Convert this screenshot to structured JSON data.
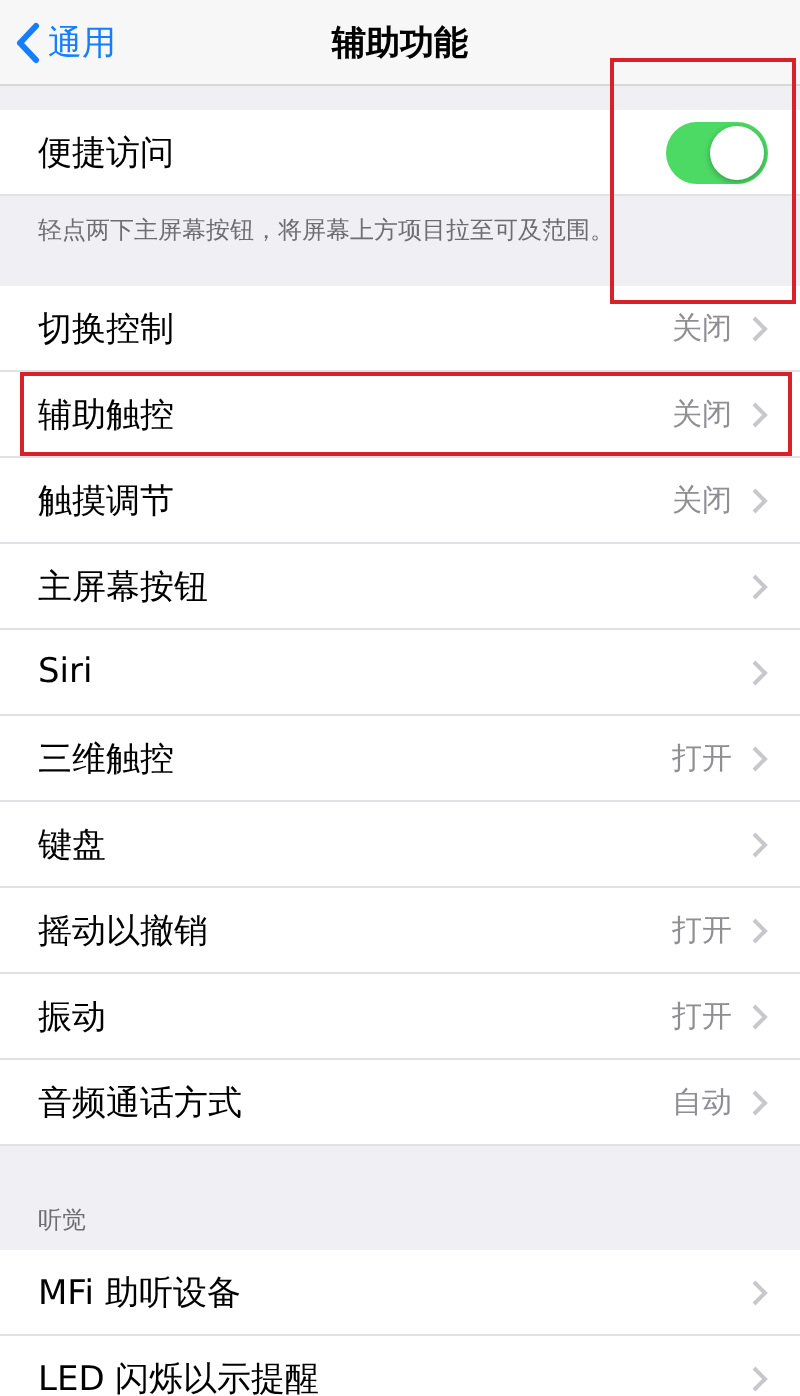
{
  "nav": {
    "back": "通用",
    "title": "辅助功能"
  },
  "reach": {
    "label": "便捷访问",
    "on": true,
    "highlighted": true,
    "footnote": "轻点两下主屏幕按钮，将屏幕上方项目拉至可及范围。"
  },
  "rows": [
    {
      "label": "切换控制",
      "value": "关闭",
      "highlighted": false
    },
    {
      "label": "辅助触控",
      "value": "关闭",
      "highlighted": true
    },
    {
      "label": "触摸调节",
      "value": "关闭",
      "highlighted": false
    },
    {
      "label": "主屏幕按钮",
      "highlighted": false
    },
    {
      "label": "Siri",
      "highlighted": false
    },
    {
      "label": "三维触控",
      "value": "打开",
      "highlighted": false
    },
    {
      "label": "键盘",
      "highlighted": false
    },
    {
      "label": "摇动以撤销",
      "value": "打开",
      "highlighted": false
    },
    {
      "label": "振动",
      "value": "打开",
      "highlighted": false
    },
    {
      "label": "音频通话方式",
      "value": "自动",
      "highlighted": false
    }
  ],
  "hearing": {
    "header": "听觉",
    "rows": [
      {
        "label": "MFi 助听设备",
        "highlighted": false
      },
      {
        "label": "LED 闪烁以示提醒",
        "highlighted": false
      }
    ]
  }
}
